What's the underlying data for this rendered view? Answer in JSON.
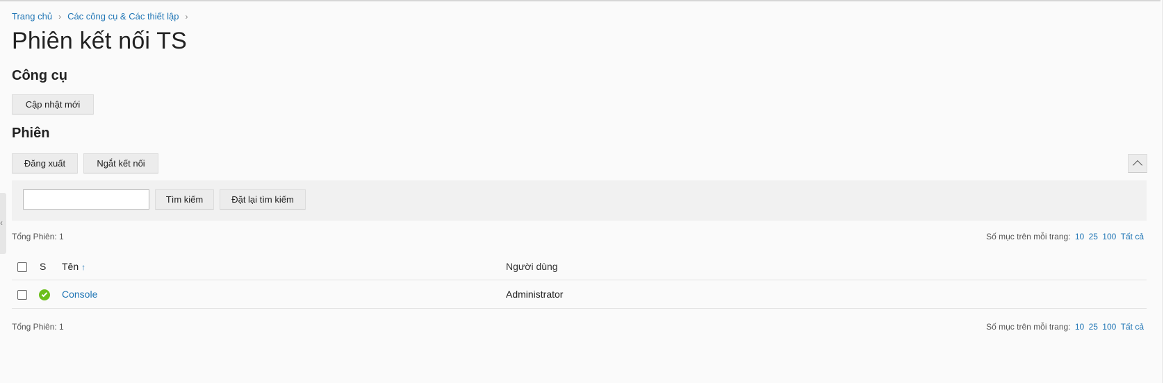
{
  "breadcrumb": {
    "home": "Trang chủ",
    "tools": "Các công cụ & Các thiết lập"
  },
  "page_title": "Phiên kết nối TS",
  "tools_section": {
    "title": "Công cụ",
    "refresh_label": "Cập nhật mới"
  },
  "sessions_section": {
    "title": "Phiên",
    "logout_label": "Đăng xuất",
    "disconnect_label": "Ngắt kết nối"
  },
  "search": {
    "value": "",
    "placeholder": "",
    "search_label": "Tìm kiếm",
    "reset_label": "Đặt lại tìm kiếm"
  },
  "summary": {
    "total": "Tổng Phiên: 1",
    "per_page_label": "Số mục trên mỗi trang:",
    "per_page_options": [
      "10",
      "25",
      "100",
      "Tất cả"
    ]
  },
  "table": {
    "headers": {
      "status": "S",
      "name": "Tên",
      "sort": "↑",
      "user": "Người dùng"
    },
    "rows": [
      {
        "status": "ok",
        "name": "Console",
        "user": "Administrator"
      }
    ]
  },
  "colors": {
    "link": "#1f75b5",
    "status_ok": "#6cbf1d"
  }
}
